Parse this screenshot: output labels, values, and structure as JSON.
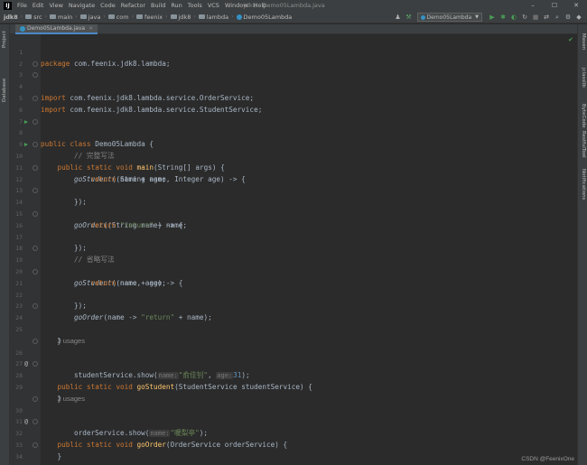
{
  "titlebar": {
    "logo": "IJ",
    "menu": [
      "File",
      "Edit",
      "View",
      "Navigate",
      "Code",
      "Refactor",
      "Build",
      "Run",
      "Tools",
      "VCS",
      "Window",
      "Help"
    ],
    "window_title": "jdk8 - Demo05Lambda.java",
    "controls": [
      "–",
      "☐",
      "✕"
    ]
  },
  "navbar": {
    "crumbs": [
      "jdk8",
      "src",
      "main",
      "java",
      "com",
      "feenix",
      "jdk8",
      "lambda",
      "Demo05Lambda"
    ],
    "run_config": "Demo05Lambda"
  },
  "left_strip": [
    "Project",
    "Database",
    "Structure"
  ],
  "right_strip": [
    "Maven",
    "jclasslib",
    "ByteCode",
    "RestfulTool",
    "Notifications"
  ],
  "tab": {
    "label": "Demo05Lambda.java",
    "close": "×"
  },
  "editor": {
    "line_numbers": [
      "1",
      "2",
      "3",
      "4",
      "5",
      "6",
      "7",
      "8",
      "9",
      "10",
      "11",
      "12",
      "13",
      "14",
      "15",
      "16",
      "17",
      "18",
      "19",
      "20",
      "21",
      "22",
      "23",
      "24",
      "25",
      "26",
      "27",
      "28",
      "29",
      "30",
      "31",
      "32",
      "33",
      "34",
      "35"
    ],
    "usages_1": "2 usages",
    "usages_2": "2 usages",
    "tokens": {
      "package": "package",
      "pkg": "com.feenix.jdk8.lambda;",
      "import": "import",
      "imp1": "com.feenix.jdk8.lambda.service.OrderService;",
      "imp2": "com.feenix.jdk8.lambda.service.StudentService;",
      "public": "public",
      "class": "class",
      "static": "static",
      "void": "void",
      "classname": "Demo05Lambda {",
      "main": "main",
      "main_params": "(String[] args) {",
      "comment1": "// 完整写法",
      "goStudent": "goStudent",
      "goOrder": "goOrder",
      "l10_rest": "((String name, Integer age) -> {",
      "return": "return",
      "l11_rest": "name + age;",
      "close_lambda": "});",
      "l14_rest": "((String name) -> {",
      "return_str": "\"return\"",
      "l15_rest": " + name;",
      "comment2": "// 省略写法",
      "l19_rest": "((name, age) -> {",
      "l23_a": "(name -> ",
      "l23_b": " + name);",
      "close_brace": "}",
      "goStudent_params": "(StudentService studentService) {",
      "l27_a": "studentService.show(",
      "hint_name": "name:",
      "hint_age": "age:",
      "str_lxh": "\"俞佳钊\"",
      "comma": ", ",
      "num31": "31",
      "l27_end": ");",
      "goOrder_params": "(OrderService orderService) {",
      "l31_a": "orderService.show(",
      "str_wlt": "\"暖梨亭\""
    },
    "icons": {
      "run_class": "▶",
      "run_main": "▶",
      "implement_26": "@",
      "implement_30": "@"
    }
  },
  "watermark": "CSDN @FeenixOne",
  "colors": {
    "keyword": "#cc7832",
    "method_decl": "#ffc66d",
    "string": "#6a8759",
    "number": "#6897bb",
    "comment": "#808080",
    "run_icon": "#499c54"
  }
}
